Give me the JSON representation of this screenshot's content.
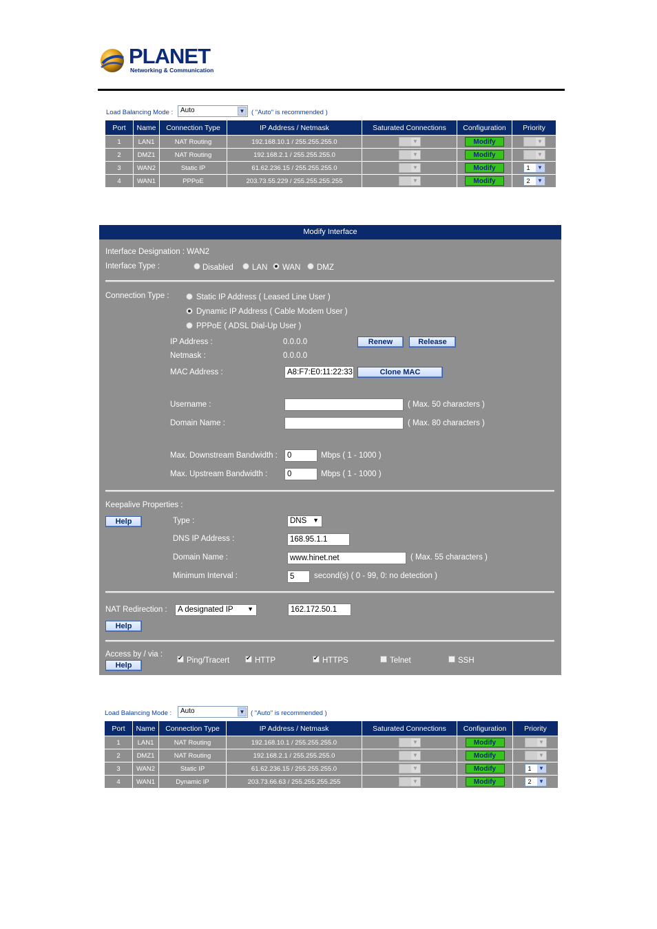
{
  "header": {
    "brand": "PLANET",
    "tagline": "Networking & Communication"
  },
  "top_table": {
    "lb_label": "Load Balancing Mode :",
    "lb_value": "Auto",
    "lb_note": "( \"Auto\" is recommended )",
    "columns": [
      "Port",
      "Name",
      "Connection Type",
      "IP Address / Netmask",
      "Saturated Connections",
      "Configuration",
      "Priority"
    ],
    "rows": [
      {
        "port": "1",
        "name": "LAN1",
        "type": "NAT Routing",
        "ip": "192.168.10.1 / 255.255.255.0",
        "config": "Modify",
        "priority": ""
      },
      {
        "port": "2",
        "name": "DMZ1",
        "type": "NAT Routing",
        "ip": "192.168.2.1 / 255.255.255.0",
        "config": "Modify",
        "priority": ""
      },
      {
        "port": "3",
        "name": "WAN2",
        "type": "Static IP",
        "ip": "61.62.236.15 / 255.255.255.0",
        "config": "Modify",
        "priority": "1"
      },
      {
        "port": "4",
        "name": "WAN1",
        "type": "PPPoE",
        "ip": "203.73.55.229 / 255.255.255.255",
        "config": "Modify",
        "priority": "2"
      }
    ]
  },
  "modify": {
    "title": "Modify Interface",
    "designation": "Interface Designation : WAN2",
    "type_label": "Interface Type :",
    "type_options": [
      "Disabled",
      "LAN",
      "WAN",
      "DMZ"
    ],
    "conn_label": "Connection Type :",
    "conn_options": [
      "Static IP Address ( Leased Line User )",
      "Dynamic IP Address ( Cable Modem User )",
      "PPPoE ( ADSL Dial-Up User )"
    ],
    "ip_label": "IP Address :",
    "ip_value": "0.0.0.0",
    "renew": "Renew",
    "release": "Release",
    "netmask_label": "Netmask :",
    "netmask_value": "0.0.0.0",
    "mac_label": "MAC Address :",
    "mac_value": "A8:F7:E0:11:22:33",
    "clone_mac": "Clone MAC",
    "username_label": "Username :",
    "username_note": "( Max. 50 characters )",
    "domain_label": "Domain Name :",
    "domain_note": "( Max. 80 characters )",
    "down_label": "Max. Downstream Bandwidth :",
    "down_value": "0",
    "down_note": "Mbps ( 1 - 1000 )",
    "up_label": "Max. Upstream Bandwidth :",
    "up_value": "0",
    "up_note": "Mbps ( 1 - 1000 )",
    "keepalive_label": "Keepalive Properties :",
    "help": "Help",
    "ka_type_label": "Type :",
    "ka_type_value": "DNS",
    "ka_dns_label": "DNS IP Address :",
    "ka_dns_value": "168.95.1.1",
    "ka_domain_label": "Domain Name :",
    "ka_domain_value": "www.hinet.net",
    "ka_domain_note": "( Max. 55 characters )",
    "ka_interval_label": "Minimum Interval :",
    "ka_interval_value": "5",
    "ka_interval_note": "second(s)  ( 0 - 99, 0: no detection )",
    "nat_label": "NAT Redirection :",
    "nat_value": "A designated IP",
    "nat_ip": "162.172.50.1",
    "access_label": "Access by / via :",
    "access_options": [
      "Ping/Tracert",
      "HTTP",
      "HTTPS",
      "Telnet",
      "SSH"
    ]
  },
  "bottom_table": {
    "lb_label": "Load Balancing Mode :",
    "lb_value": "Auto",
    "lb_note": "( \"Auto\" is recommended )",
    "columns": [
      "Port",
      "Name",
      "Connection Type",
      "IP Address / Netmask",
      "Saturated Connections",
      "Configuration",
      "Priority"
    ],
    "rows": [
      {
        "port": "1",
        "name": "LAN1",
        "type": "NAT Routing",
        "ip": "192.168.10.1 / 255.255.255.0",
        "config": "Modify",
        "priority": ""
      },
      {
        "port": "2",
        "name": "DMZ1",
        "type": "NAT Routing",
        "ip": "192.168.2.1 / 255.255.255.0",
        "config": "Modify",
        "priority": ""
      },
      {
        "port": "3",
        "name": "WAN2",
        "type": "Static IP",
        "ip": "61.62.236.15 / 255.255.255.0",
        "config": "Modify",
        "priority": "1"
      },
      {
        "port": "4",
        "name": "WAN1",
        "type": "Dynamic IP",
        "ip": "203.73.66.63 / 255.255.255.255",
        "config": "Modify",
        "priority": "2"
      }
    ]
  }
}
